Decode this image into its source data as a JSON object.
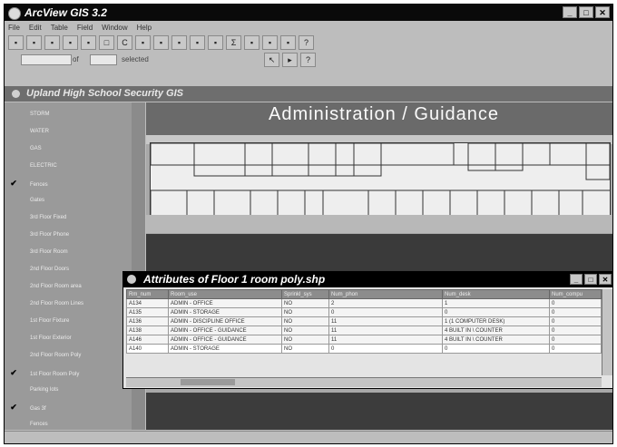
{
  "window": {
    "title": "ArcView GIS 3.2",
    "controls": [
      "_",
      "□",
      "✕"
    ]
  },
  "menu": [
    "File",
    "Edit",
    "Table",
    "Field",
    "Window",
    "Help"
  ],
  "toolbar": [
    "▪",
    "▪",
    "▪",
    "▪",
    "▪",
    "□",
    "C",
    "▪",
    "▪",
    "▪",
    "▪",
    "▪",
    "Σ",
    "▪",
    "▪",
    "▪",
    "?"
  ],
  "toolbar2": {
    "scale_unit": "of",
    "selected_label": "selected",
    "pointer_buttons": [
      "↖",
      "▸",
      "?"
    ]
  },
  "view": {
    "title": "Upland High School Security GIS"
  },
  "toc": [
    {
      "label": "STORM",
      "checked": false
    },
    {
      "label": "WATER",
      "checked": false
    },
    {
      "label": "GAS",
      "checked": false
    },
    {
      "label": "ELECTRIC",
      "checked": false
    },
    {
      "label": "Fences",
      "checked": true
    },
    {
      "label": "Gates",
      "checked": false
    },
    {
      "label": "3rd Floor Fixed",
      "checked": false
    },
    {
      "label": "3rd Floor Phone",
      "checked": false
    },
    {
      "label": "3rd Floor Room",
      "checked": false
    },
    {
      "label": "2nd Floor Doors",
      "checked": false
    },
    {
      "label": "2nd Floor Room area",
      "checked": false
    },
    {
      "label": "2nd Floor Room Lines",
      "checked": false
    },
    {
      "label": "1st Floor Fixture",
      "checked": false
    },
    {
      "label": "1st Floor Exterior",
      "checked": false
    },
    {
      "label": "2nd Floor Room Poly",
      "checked": false
    },
    {
      "label": "1st Floor Room Poly",
      "checked": true
    },
    {
      "label": "Parking lots",
      "checked": false
    },
    {
      "label": "Gas 3f",
      "checked": true
    },
    {
      "label": "Fences",
      "checked": false
    }
  ],
  "map": {
    "label": "Administration / Guidance"
  },
  "attributes": {
    "title": "Attributes of Floor 1 room poly.shp",
    "controls": [
      "_",
      "□",
      "✕"
    ],
    "columns": [
      "Rm_num",
      "Room_use",
      "Sprinkl_sys",
      "Num_phon",
      "Num_desk",
      "Num_compu"
    ],
    "rows": [
      [
        "A134",
        "ADMIN - OFFICE",
        "NO",
        "2",
        "1",
        "0"
      ],
      [
        "A135",
        "ADMIN - STORAGE",
        "NO",
        "0",
        "0",
        "0"
      ],
      [
        "A136",
        "ADMIN - DISCIPLINE OFFICE",
        "NO",
        "11",
        "1 (1 COMPUTER DESK)",
        "0"
      ],
      [
        "A138",
        "ADMIN - OFFICE - GUIDANCE",
        "NO",
        "11",
        "4 BUILT IN \\ COUNTER",
        "0"
      ],
      [
        "A146",
        "ADMIN - OFFICE - GUIDANCE",
        "NO",
        "11",
        "4 BUILT IN \\ COUNTER",
        "0"
      ],
      [
        "A140",
        "ADMIN - STORAGE",
        "NO",
        "0",
        "0",
        "0"
      ]
    ]
  }
}
